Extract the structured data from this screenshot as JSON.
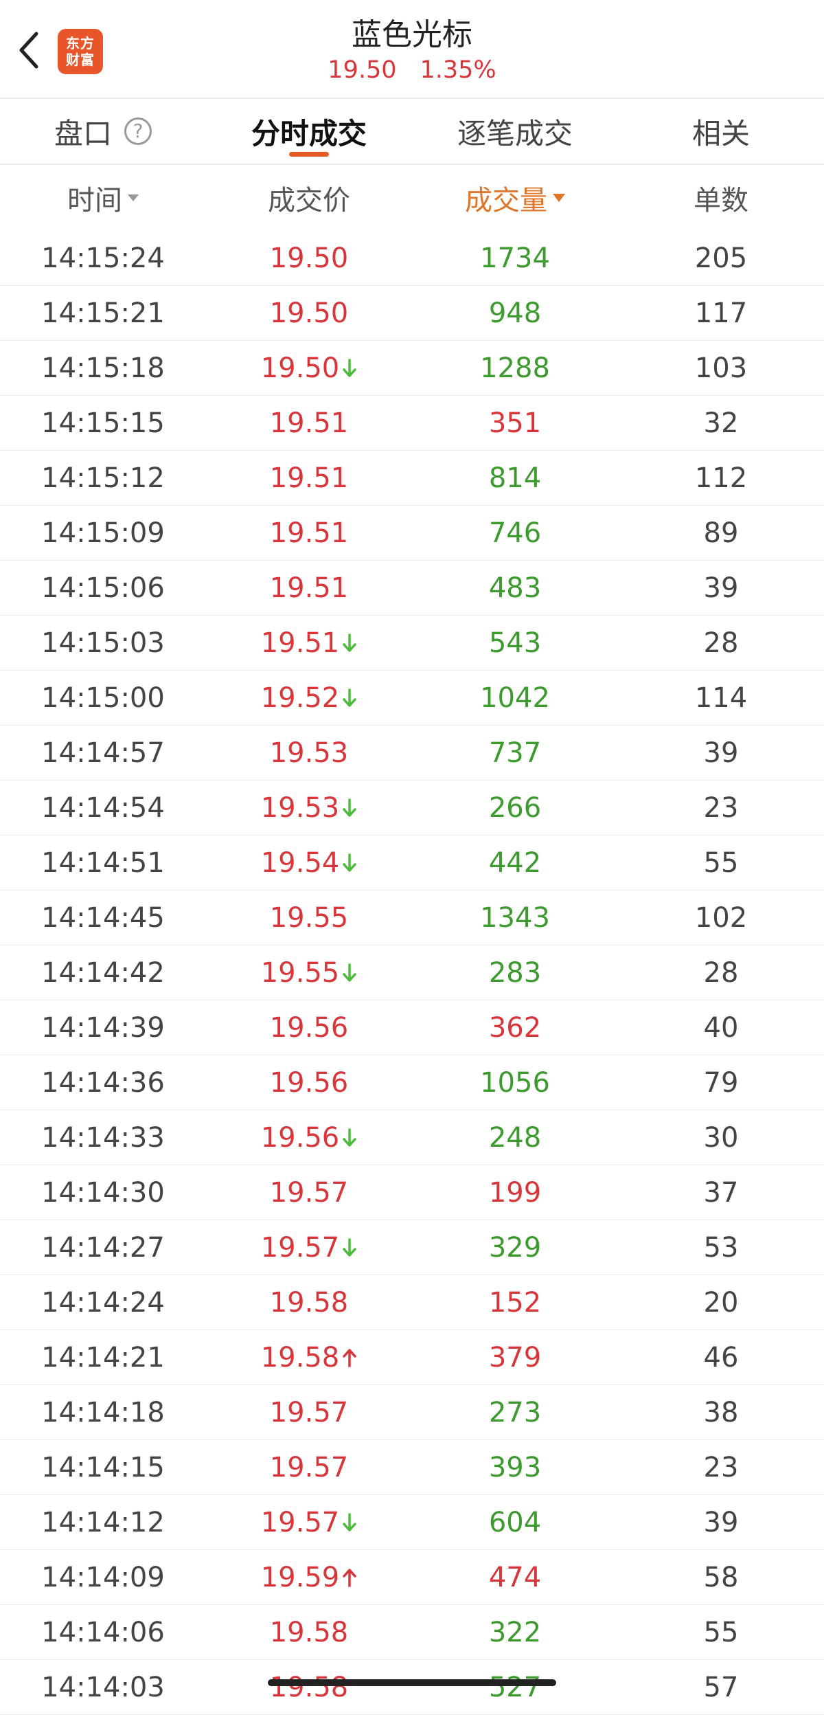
{
  "header": {
    "logo_line1": "东方",
    "logo_line2": "财富",
    "stock_name": "蓝色光标",
    "price": "19.50",
    "change_pct": "1.35%"
  },
  "colors": {
    "up_red": "#d8363a",
    "down_green": "#3c9a2e",
    "arrow_green": "#4cbc3c",
    "accent_orange": "#e35a27",
    "logo_bg": "#e8552a"
  },
  "tabs": [
    {
      "label": "盘口",
      "active": false,
      "has_help_icon": true
    },
    {
      "label": "分时成交",
      "active": true
    },
    {
      "label": "逐笔成交",
      "active": false
    },
    {
      "label": "相关",
      "active": false
    }
  ],
  "table": {
    "columns": [
      {
        "label": "时间",
        "sortable": true,
        "active_sort": false
      },
      {
        "label": "成交价",
        "sortable": false
      },
      {
        "label": "成交量",
        "sortable": true,
        "active_sort": true
      },
      {
        "label": "单数",
        "sortable": false
      }
    ],
    "rows": [
      {
        "time": "14:15:24",
        "price": "19.50",
        "arrow": "",
        "volume": "1734",
        "volume_color": "green",
        "count": "205"
      },
      {
        "time": "14:15:21",
        "price": "19.50",
        "arrow": "",
        "volume": "948",
        "volume_color": "green",
        "count": "117"
      },
      {
        "time": "14:15:18",
        "price": "19.50",
        "arrow": "down",
        "volume": "1288",
        "volume_color": "green",
        "count": "103"
      },
      {
        "time": "14:15:15",
        "price": "19.51",
        "arrow": "",
        "volume": "351",
        "volume_color": "red",
        "count": "32"
      },
      {
        "time": "14:15:12",
        "price": "19.51",
        "arrow": "",
        "volume": "814",
        "volume_color": "green",
        "count": "112"
      },
      {
        "time": "14:15:09",
        "price": "19.51",
        "arrow": "",
        "volume": "746",
        "volume_color": "green",
        "count": "89"
      },
      {
        "time": "14:15:06",
        "price": "19.51",
        "arrow": "",
        "volume": "483",
        "volume_color": "green",
        "count": "39"
      },
      {
        "time": "14:15:03",
        "price": "19.51",
        "arrow": "down",
        "volume": "543",
        "volume_color": "green",
        "count": "28"
      },
      {
        "time": "14:15:00",
        "price": "19.52",
        "arrow": "down",
        "volume": "1042",
        "volume_color": "green",
        "count": "114"
      },
      {
        "time": "14:14:57",
        "price": "19.53",
        "arrow": "",
        "volume": "737",
        "volume_color": "green",
        "count": "39"
      },
      {
        "time": "14:14:54",
        "price": "19.53",
        "arrow": "down",
        "volume": "266",
        "volume_color": "green",
        "count": "23"
      },
      {
        "time": "14:14:51",
        "price": "19.54",
        "arrow": "down",
        "volume": "442",
        "volume_color": "green",
        "count": "55"
      },
      {
        "time": "14:14:45",
        "price": "19.55",
        "arrow": "",
        "volume": "1343",
        "volume_color": "green",
        "count": "102"
      },
      {
        "time": "14:14:42",
        "price": "19.55",
        "arrow": "down",
        "volume": "283",
        "volume_color": "green",
        "count": "28"
      },
      {
        "time": "14:14:39",
        "price": "19.56",
        "arrow": "",
        "volume": "362",
        "volume_color": "red",
        "count": "40"
      },
      {
        "time": "14:14:36",
        "price": "19.56",
        "arrow": "",
        "volume": "1056",
        "volume_color": "green",
        "count": "79"
      },
      {
        "time": "14:14:33",
        "price": "19.56",
        "arrow": "down",
        "volume": "248",
        "volume_color": "green",
        "count": "30"
      },
      {
        "time": "14:14:30",
        "price": "19.57",
        "arrow": "",
        "volume": "199",
        "volume_color": "red",
        "count": "37"
      },
      {
        "time": "14:14:27",
        "price": "19.57",
        "arrow": "down",
        "volume": "329",
        "volume_color": "green",
        "count": "53"
      },
      {
        "time": "14:14:24",
        "price": "19.58",
        "arrow": "",
        "volume": "152",
        "volume_color": "red",
        "count": "20"
      },
      {
        "time": "14:14:21",
        "price": "19.58",
        "arrow": "up",
        "volume": "379",
        "volume_color": "red",
        "count": "46"
      },
      {
        "time": "14:14:18",
        "price": "19.57",
        "arrow": "",
        "volume": "273",
        "volume_color": "green",
        "count": "38"
      },
      {
        "time": "14:14:15",
        "price": "19.57",
        "arrow": "",
        "volume": "393",
        "volume_color": "green",
        "count": "23"
      },
      {
        "time": "14:14:12",
        "price": "19.57",
        "arrow": "down",
        "volume": "604",
        "volume_color": "green",
        "count": "39"
      },
      {
        "time": "14:14:09",
        "price": "19.59",
        "arrow": "up",
        "volume": "474",
        "volume_color": "red",
        "count": "58"
      },
      {
        "time": "14:14:06",
        "price": "19.58",
        "arrow": "",
        "volume": "322",
        "volume_color": "green",
        "count": "55"
      },
      {
        "time": "14:14:03",
        "price": "19.58",
        "arrow": "",
        "volume": "527",
        "volume_color": "green",
        "count": "57"
      }
    ]
  }
}
